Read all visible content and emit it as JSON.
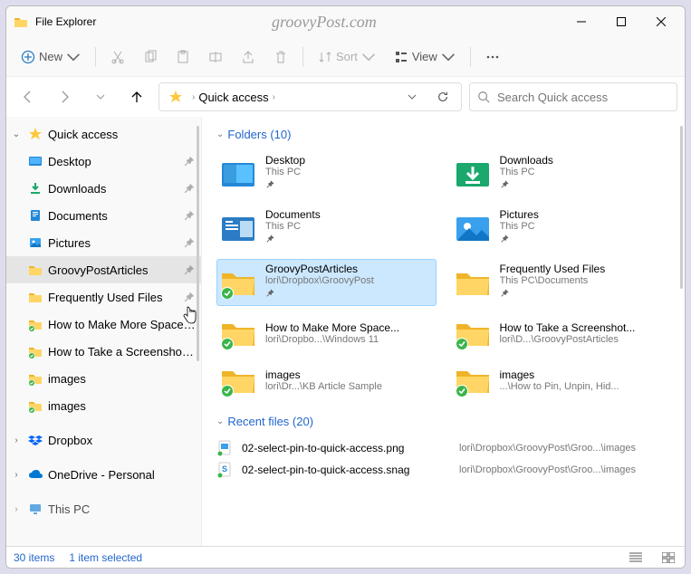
{
  "window": {
    "title": "File Explorer",
    "watermark": "groovyPost.com"
  },
  "toolbar": {
    "new": "New",
    "sort": "Sort",
    "view": "View"
  },
  "addr": {
    "crumb": "Quick access"
  },
  "search": {
    "placeholder": "Search Quick access"
  },
  "sidebar": {
    "quickaccess": "Quick access",
    "items": [
      {
        "label": "Desktop",
        "icon": "desktop",
        "pin": true
      },
      {
        "label": "Downloads",
        "icon": "downloads",
        "pin": true
      },
      {
        "label": "Documents",
        "icon": "documents",
        "pin": true
      },
      {
        "label": "Pictures",
        "icon": "pictures",
        "pin": true
      },
      {
        "label": "GroovyPostArticles",
        "icon": "folder",
        "pin": true,
        "sel": true
      },
      {
        "label": "Frequently Used Files",
        "icon": "folder",
        "pin": true
      },
      {
        "label": "How to Make More Space Av",
        "icon": "folder-sync",
        "pin": false
      },
      {
        "label": "How to Take a Screenshot on",
        "icon": "folder-sync",
        "pin": false
      },
      {
        "label": "images",
        "icon": "folder-sync",
        "pin": false
      },
      {
        "label": "images",
        "icon": "folder-sync",
        "pin": false
      }
    ],
    "dropbox": "Dropbox",
    "onedrive": "OneDrive - Personal",
    "thispc": "This PC"
  },
  "content": {
    "folders_hdr": "Folders (10)",
    "recent_hdr": "Recent files (20)",
    "folders": [
      {
        "name": "Desktop",
        "path": "This PC",
        "icon": "desktop-big",
        "pin": true
      },
      {
        "name": "Downloads",
        "path": "This PC",
        "icon": "downloads-big",
        "pin": true
      },
      {
        "name": "Documents",
        "path": "This PC",
        "icon": "documents-big",
        "pin": true
      },
      {
        "name": "Pictures",
        "path": "This PC",
        "icon": "pictures-big",
        "pin": true
      },
      {
        "name": "GroovyPostArticles",
        "path": "lori\\Dropbox\\GroovyPost",
        "icon": "folder-sync-big",
        "pin": true,
        "sel": true
      },
      {
        "name": "Frequently Used Files",
        "path": "This PC\\Documents",
        "icon": "folder-big",
        "pin": true
      },
      {
        "name": "How to Make More Space...",
        "path": "lori\\Dropbo...\\Windows 11",
        "icon": "folder-sync-big",
        "pin": false
      },
      {
        "name": "How to Take a Screenshot...",
        "path": "lori\\D...\\GroovyPostArticles",
        "icon": "folder-sync-big",
        "pin": false
      },
      {
        "name": "images",
        "path": "lori\\Dr...\\KB Article Sample",
        "icon": "folder-sync-big",
        "pin": false
      },
      {
        "name": "images",
        "path": "...\\How to Pin, Unpin, Hid...",
        "icon": "folder-sync-big",
        "pin": false
      }
    ],
    "recent": [
      {
        "name": "02-select-pin-to-quick-access.png",
        "path": "lori\\Dropbox\\GroovyPost\\Groo...\\images",
        "icon": "png"
      },
      {
        "name": "02-select-pin-to-quick-access.snag",
        "path": "lori\\Dropbox\\GroovyPost\\Groo...\\images",
        "icon": "snag"
      }
    ]
  },
  "status": {
    "items": "30 items",
    "selected": "1 item selected"
  }
}
